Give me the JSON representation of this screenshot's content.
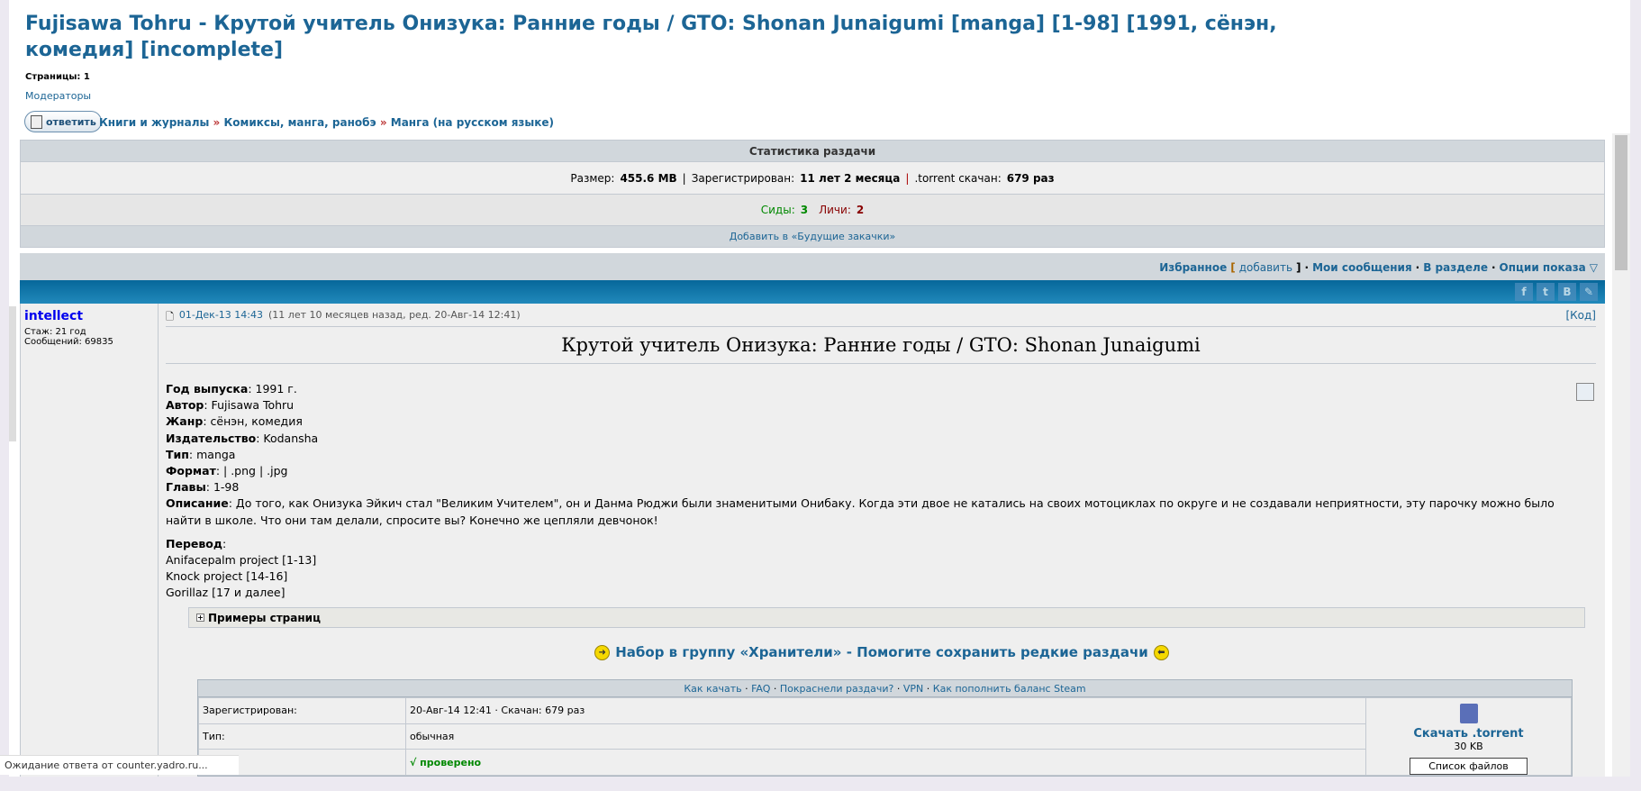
{
  "topic": {
    "title": "Fujisawa Tohru - Крутой учитель Онизука: Ранние годы / GTO: Shonan Junaigumi [manga] [1-98] [1991, сёнэн, комедия] [incomplete]",
    "pages_label": "Страницы:",
    "pages_value": "1",
    "moderators": "Модераторы",
    "reply_button": "ответить"
  },
  "breadcrumbs": [
    "Книги и журналы",
    "Комиксы, манга, ранобэ",
    "Манга (на русском языке)"
  ],
  "crumb_sep": "»",
  "stats": {
    "header": "Статистика раздачи",
    "size_label": "Размер:",
    "size": "455.6 MB",
    "registered_label": "Зарегистрирован:",
    "registered": "11 лет 2 месяца",
    "downloaded_label": ".torrent скачан:",
    "downloaded": "679 раз",
    "seeds_label": "Сиды:",
    "seeds": "3",
    "leech_label": "Личи:",
    "leech": "2",
    "add_future": "Добавить в «Будущие закачки»",
    "sep": "|"
  },
  "nav": {
    "favorites": "Избранное",
    "add": "добавить",
    "my_posts": "Мои сообщения",
    "in_section": "В разделе",
    "view_options": "Опции показа"
  },
  "social": [
    "f",
    "t",
    "B",
    "✎"
  ],
  "author": {
    "nick": "intellect",
    "tenure": "Стаж: 21 год",
    "posts": "Сообщений: 69835"
  },
  "post": {
    "date": "01-Дек-13 14:43",
    "ago": "(11 лет 10 месяцев назад, ред. 20-Авг-14 12:41)",
    "code": "[Код]",
    "heading": "Крутой учитель Онизука: Ранние годы / GTO: Shonan Junaigumi",
    "fields": [
      {
        "k": "Год выпуска",
        "v": ": 1991 г."
      },
      {
        "k": "Автор",
        "v": ": Fujisawa Tohru"
      },
      {
        "k": "Жанр",
        "v": ": сёнэн, комедия"
      },
      {
        "k": "Издательство",
        "v": ": Kodansha"
      },
      {
        "k": "Тип",
        "v": ": manga"
      },
      {
        "k": "Формат",
        "v": ": | .png | .jpg"
      },
      {
        "k": "Главы",
        "v": ": 1-98"
      },
      {
        "k": "Описание",
        "v": ": До того, как Онизука Эйкич стал \"Великим Учителем\", он и Данма Рюджи были знаменитыми Онибаку. Когда эти двое не катались на своих мотоциклах по округе и не создавали неприятности, эту парочку можно было найти в школе. Что они там делали, спросите вы? Конечно же цепляли девчонок!"
      }
    ],
    "translation_label": "Перевод",
    "translations": [
      "Anifacepalm project [1-13]",
      "Knock project [14-16]",
      "Gorillaz [17 и далее]"
    ],
    "spoiler": "Примеры страниц",
    "banner": "Набор в группу «Хранители» - Помогите сохранить редкие раздачи"
  },
  "torrent": {
    "links": [
      "Как качать",
      "FAQ",
      "Покраснели раздачи?",
      "VPN",
      "Как пополнить баланс Steam"
    ],
    "rows": [
      {
        "k": "Зарегистрирован:",
        "v": "20-Авг-14 12:41 · Скачан: 679 раз"
      },
      {
        "k": "Тип:",
        "v": "обычная"
      },
      {
        "k": "",
        "v": "√ проверено"
      }
    ],
    "download": "Скачать .torrent",
    "size": "30 KB",
    "files": "Список файлов"
  },
  "status_bar": "Ожидание ответа от counter.yadro.ru...",
  "colors": {
    "link": "#1c6595",
    "bar": "#06679a",
    "seeds": "#008000",
    "leech": "#800000"
  }
}
